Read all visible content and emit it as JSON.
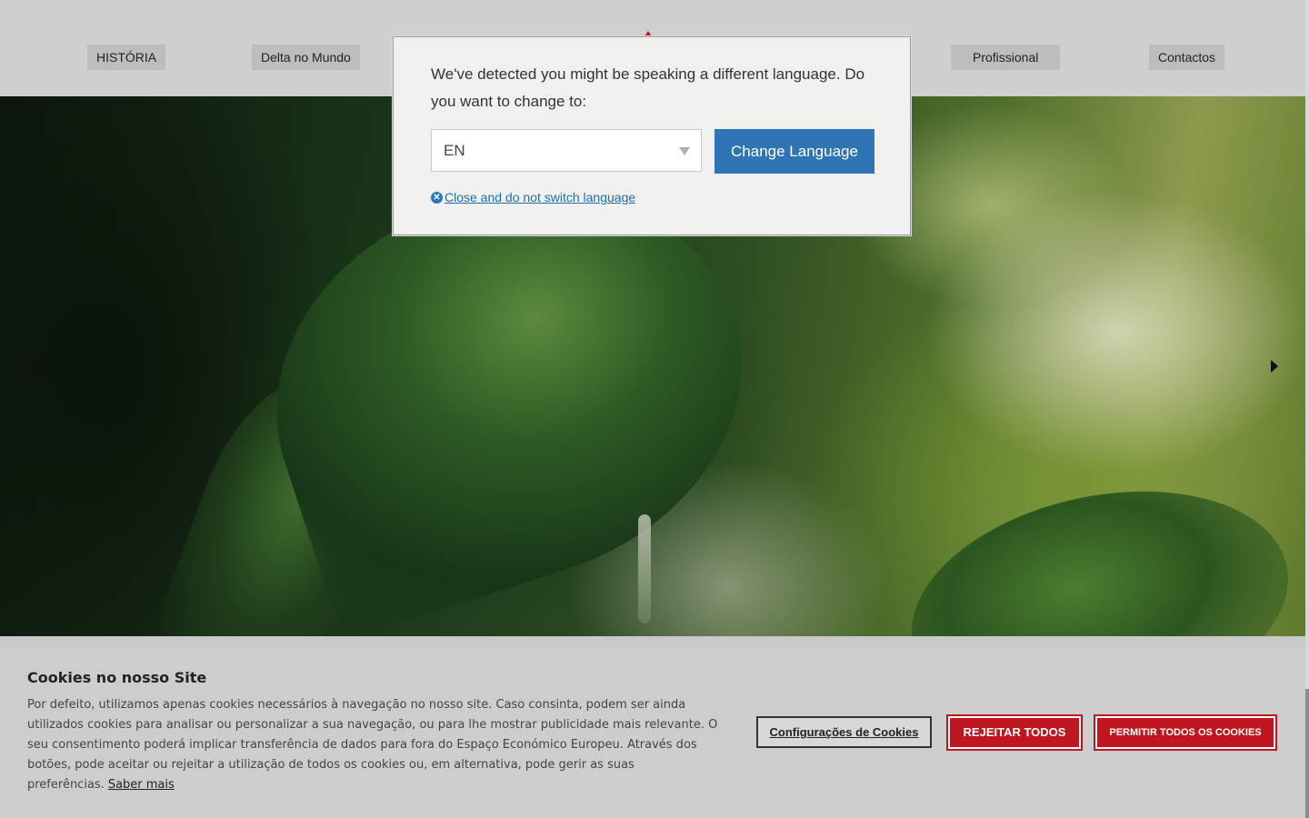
{
  "nav": {
    "items": [
      {
        "label": "HISTÓRIA"
      },
      {
        "label": "Delta no Mundo"
      },
      {
        "label": "Profissional"
      },
      {
        "label": "Contactos"
      }
    ]
  },
  "hero": {
    "prev_icon": "triangle-left-icon",
    "next_icon": "triangle-right-icon"
  },
  "language_modal": {
    "message": "We've detected you might be speaking a different language. Do you want to change to:",
    "selected_language": "EN",
    "change_button": "Change Language",
    "close_link": "Close and do not switch language",
    "close_icon": "circle-x-icon",
    "accent_color": "#2f74b5"
  },
  "cookie_banner": {
    "title": "Cookies no nosso Site",
    "text": "Por defeito, utilizamos apenas cookies necessários à navegação no nosso site. Caso consinta, podem ser ainda utilizados cookies para analisar ou personalizar a sua navegação, ou para lhe mostrar publicidade mais relevante. O seu consentimento poderá implicar transferência de dados para fora do Espaço Económico Europeu. Através dos botões, pode aceitar ou rejeitar a utilização de todos os cookies ou, em alternativa, pode gerir as suas preferências.",
    "learn_more": "Saber mais",
    "settings_button": "Configurações de Cookies",
    "reject_button": "REJEITAR TODOS",
    "accept_button": "PERMITIR TODOS OS COOKIES",
    "brand_color": "#c0161f"
  }
}
